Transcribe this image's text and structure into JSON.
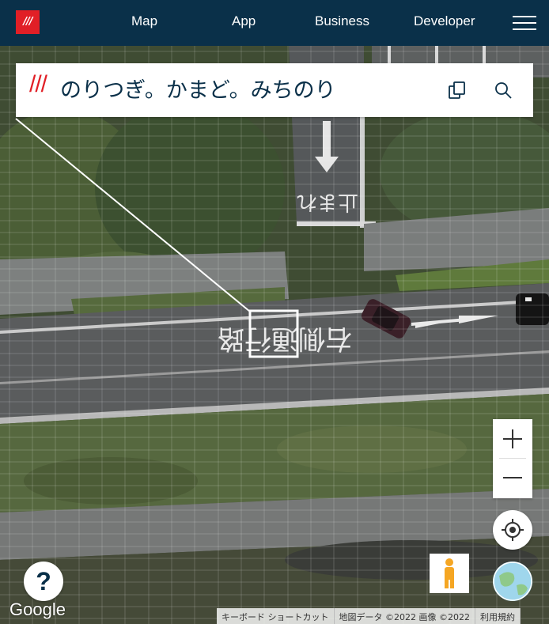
{
  "nav": {
    "logo_text": "///",
    "items": [
      "Map",
      "App",
      "Business",
      "Developer"
    ]
  },
  "address": {
    "prefix": "///",
    "words": "のりつぎ。かまど。みちのり"
  },
  "map": {
    "road_marking_text": "右側通行路",
    "controls": {
      "zoom_in": "+",
      "zoom_out": "—",
      "help": "?"
    },
    "google_logo": "Google",
    "attribution": {
      "keyboard_shortcuts": "キーボード ショートカット",
      "map_data": "地図データ ©2022 画像 ©2022",
      "terms": "利用規約"
    }
  },
  "colors": {
    "navy": "#0a3049",
    "brand_red": "#e11f26"
  }
}
